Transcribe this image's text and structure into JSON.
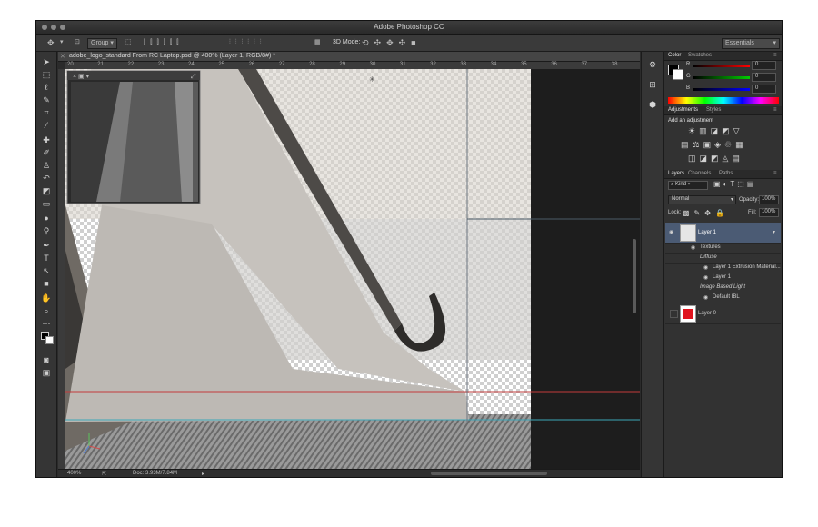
{
  "app": {
    "title": "Adobe Photoshop CC"
  },
  "options_bar": {
    "auto_select": "Group",
    "mode_label": "3D Mode:",
    "workspace": "Essentials"
  },
  "document": {
    "tab_title": "adobe_logo_standard From RC Laptop.psd @ 400% (Layer 1, RGB/8#) *",
    "zoom": "400%",
    "doc_size": "Doc: 3.93M/7.84M",
    "ruler_ticks": [
      "20",
      "21",
      "22",
      "23",
      "24",
      "25",
      "26",
      "27",
      "28",
      "29",
      "30",
      "31",
      "32",
      "33",
      "34",
      "35",
      "36",
      "37",
      "38"
    ]
  },
  "color_panel": {
    "tabs": [
      "Color",
      "Swatches"
    ],
    "channels": [
      {
        "label": "R",
        "value": "0"
      },
      {
        "label": "G",
        "value": "0"
      },
      {
        "label": "B",
        "value": "0"
      }
    ]
  },
  "adjustments_panel": {
    "tabs": [
      "Adjustments",
      "Styles"
    ],
    "heading": "Add an adjustment"
  },
  "layers_panel": {
    "tabs": [
      "Layers",
      "Channels",
      "Paths"
    ],
    "filter": "Kind",
    "blend_mode": "Normal",
    "opacity_label": "Opacity:",
    "opacity": "100%",
    "lock_label": "Lock:",
    "fill_label": "Fill:",
    "fill": "100%",
    "layers": [
      {
        "name": "Layer 1"
      },
      {
        "name": "Textures"
      },
      {
        "name": "Diffuse"
      },
      {
        "name": "Layer 1 Extrusion Material..."
      },
      {
        "name": "Layer 1"
      },
      {
        "name": "Image Based Light"
      },
      {
        "name": "Default IBL"
      },
      {
        "name": "Layer 0"
      }
    ]
  },
  "colors": {
    "window_bg": "#2b2b2b",
    "selected_layer": "#4b5b74",
    "guide_red": "#c23b3b",
    "guide_cyan": "#3aa6b8"
  }
}
